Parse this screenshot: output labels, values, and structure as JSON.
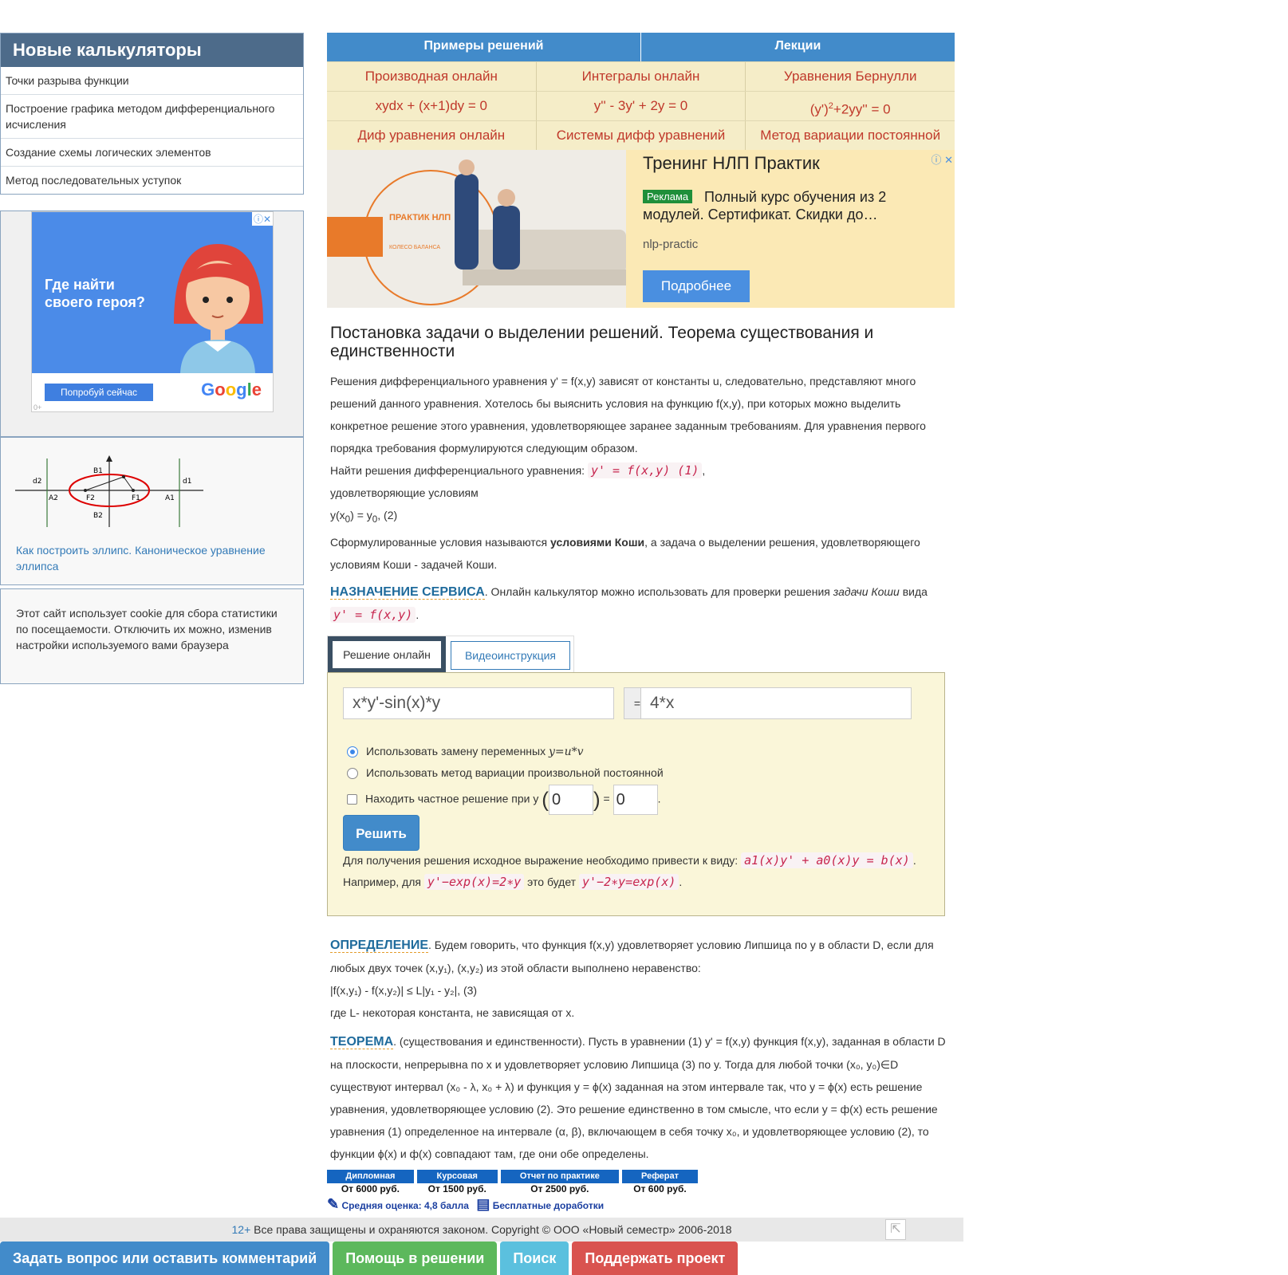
{
  "sidebar": {
    "new_calcs_title": "Новые калькуляторы",
    "new_calcs": [
      "Точки разрыва функции",
      "Построение графика методом дифференциального исчисления",
      "Создание схемы логических элементов",
      "Метод последовательных уступок"
    ],
    "ad": {
      "headline": "Где найти своего героя?",
      "button": "Попробуй сейчас",
      "brand": "Google"
    },
    "ellipse_labels": {
      "d2": "d2",
      "d1": "d1",
      "b1": "B1",
      "b2": "B2",
      "a2": "A2",
      "a1": "A1",
      "f2": "F2",
      "f1": "F1"
    },
    "ellipse_link": "Как построить эллипс. Каноническое уравнение эллипса",
    "cookie_notice": "Этот сайт использует cookie для сбора статистики по посещаемости. Отключить их можно, изменив настройки используемого вами браузера"
  },
  "nav": {
    "top": [
      "Примеры решений",
      "Лекции"
    ],
    "row1": [
      "Производная онлайн",
      "Интегралы онлайн",
      "Уравнения Бернулли"
    ],
    "row2": [
      "xydx + (x+1)dy = 0",
      "y'' - 3y' + 2y = 0",
      "(y')",
      "2",
      "+2yy'' = 0"
    ],
    "row3": [
      "Диф уравнения онлайн",
      "Системы дифф уравнений",
      "Метод вариации постоянной"
    ]
  },
  "ad2": {
    "title": "Тренинг НЛП Практик",
    "tag": "Реклама",
    "desc": "Полный курс обучения из 2",
    "desc2": "модулей. Сертификат. Скидки до…",
    "domain": "nlp-practic",
    "button": "Подробнее",
    "image_caption": "ПРАКТИК НЛП",
    "image_sub": "КОЛЕСО БАЛАНСА"
  },
  "article": {
    "title": "Постановка задачи о выделении решений. Теорема существования и единственности",
    "p1": "Решения дифференциального уравнения y' = f(x,y) зависят от константы u, следовательно, представляют много решений данного уравнения. Хотелось бы выяснить условия на функцию f(x,y), при которых можно выделить конкретное решение этого уравнения, удовлетворяющее заранее заданным требованиям. Для уравнения первого порядка требования формулируются следующим образом.",
    "find_prefix": "Найти решения дифференциального уравнения:",
    "find_eq": "y' = f(x,y) (1)",
    "conditions": "удовлетворяющие условиям",
    "cond_eq": "y(x",
    "cond_eq2": ") = y",
    "cond_eq3": ", (2)",
    "cauchy_prefix": "Сформулированные условия называются",
    "cauchy_bold": "условиями Коши",
    "cauchy_suffix": ", а задача о выделении решения, удовлетворяющего условиям Коши - задачей Коши.",
    "service_kw": "НАЗНАЧЕНИЕ СЕРВИСА",
    "service_text": ". Онлайн калькулятор можно использовать для проверки решения",
    "service_em": "задачи Коши",
    "service_text2": "вида",
    "service_eq": "y' = f(x,y)"
  },
  "tabs": {
    "active": "Решение онлайн",
    "other": "Видеоинструкция"
  },
  "solver": {
    "left_value": "x*y'-sin(x)*y",
    "eq_sign": "=",
    "right_value": "4*x",
    "opt1": "Использовать замену переменных",
    "opt1_math": "y=u*v",
    "opt2": "Использовать метод вариации произвольной постоянной",
    "opt3": "Находить частное решение при y",
    "x0": "0",
    "y0": "0",
    "solve_btn": "Решить",
    "hint1": "Для получения решения исходное выражение необходимо привести к виду:",
    "hint1_eq": "a1(x)y' + a0(x)y = b(x)",
    "hint2a": "Например, для",
    "hint2_eq1": "y'−exp(x)=2∗y",
    "hint2b": "это будет",
    "hint2_eq2": "y'−2∗y=exp(x)"
  },
  "definition": {
    "kw": "ОПРЕДЕЛЕНИЕ",
    "text": ". Будем говорить, что функция f(x,y) удовлетворяет условию Липшица по y в области D, если для любых двух точек (x,y₁), (x,y₂) из этой области выполнено неравенство:",
    "ineq": "|f(x,y₁) - f(x,y₂)| ≤ L|y₁ - y₂|, (3)",
    "where": "где L- некоторая константа, не зависящая от x."
  },
  "theorem": {
    "kw": "ТЕОРЕМА",
    "text": ". (существования и единственности). Пусть в уравнении (1) y' = f(x,y) функция f(x,y), заданная в области D на плоскости, непрерывна по x и удовлетворяет условию Липшица (3) по y. Тогда для любой точки (x₀, y₀)∈D существуют интервал (x₀ - λ, x₀ + λ) и функция y = ϕ(x) заданная на этом интервале так, что y = ϕ(x) есть решение уравнения, удовлетворяющее условию (2). Это решение единственно в том смысле, что если y = ф(x) есть решение уравнения (1) определенное на интервале (α, β), включающем в себя точку x₀, и удовлетворяющее условию (2), то функции ϕ(x) и ф(x) совпадают там, где они обе определены."
  },
  "promo": {
    "heads": [
      "Дипломная",
      "Курсовая",
      "Отчет по практике",
      "Реферат"
    ],
    "prices": [
      "От 6000 руб.",
      "От 1500 руб.",
      "От 2500 руб.",
      "От 600 руб."
    ],
    "rating": "Средняя оценка: 4,8 балла",
    "free": "Бесплатные доработки"
  },
  "footer": {
    "age": "12+",
    "copyright": "Все права защищены и охраняются законом. Copyright © ООО «Новый семестр» 2006-2018"
  },
  "bottom_bar": [
    "Задать вопрос или оставить комментарий",
    "Помощь в решении",
    "Поиск",
    "Поддержать проект"
  ],
  "colors": {
    "accent": "#428bca",
    "nav_text": "#c0392b",
    "ask": "#428bca",
    "help": "#5cb85c",
    "search": "#5bc0de",
    "support": "#d9534f"
  }
}
